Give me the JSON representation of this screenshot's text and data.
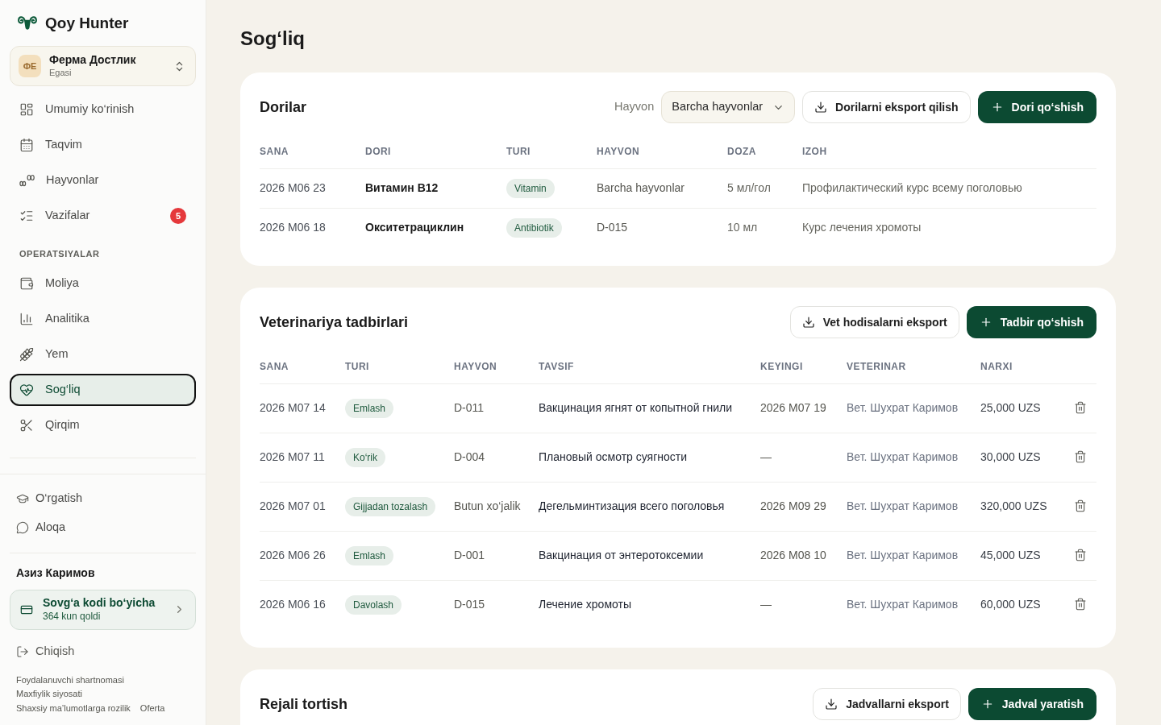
{
  "sidebar": {
    "brand": "Qoy Hunter",
    "farm": {
      "initials": "ФЕ",
      "name": "Ферма Достлик",
      "role": "Egasi"
    },
    "nav": [
      {
        "kind": "overview",
        "label": "Umumiy ko‘rinish",
        "selected": false
      },
      {
        "kind": "calendar",
        "label": "Taqvim",
        "selected": false
      },
      {
        "kind": "animals",
        "label": "Hayvonlar",
        "selected": false
      },
      {
        "kind": "tasks",
        "label": "Vazifalar",
        "selected": false,
        "badge": "5"
      }
    ],
    "section_title": "OPERATSIYALAR",
    "operations": [
      {
        "kind": "finance",
        "label": "Moliya",
        "selected": false
      },
      {
        "kind": "analytics",
        "label": "Analitika",
        "selected": false
      },
      {
        "kind": "feed",
        "label": "Yem",
        "selected": false
      },
      {
        "kind": "health",
        "label": "Sog‘liq",
        "selected": true
      },
      {
        "kind": "shearing",
        "label": "Qirqim",
        "selected": false
      }
    ],
    "help_links": [
      {
        "kind": "learning",
        "label": "O‘rgatish"
      },
      {
        "kind": "contact",
        "label": "Aloqa"
      }
    ],
    "user_name": "Азиз Каримов",
    "subscription": {
      "title": "Sovg‘a kodi bo‘yicha",
      "remaining": "364 kun qoldi"
    },
    "logout": "Chiqish",
    "legal_links": [
      [
        "Foydalanuvchi shartnomasi"
      ],
      [
        "Maxfiylik siyosati"
      ],
      [
        "Shaxsiy ma’lumotlarga rozilik",
        "Oferta"
      ]
    ]
  },
  "page_title": "Sog‘liq",
  "medicines": {
    "title": "Dorilar",
    "filter": {
      "label": "Hayvon",
      "value": "Barcha hayvonlar"
    },
    "export_button": "Dorilarni eksport qilish",
    "add_button": "Dori qo‘shish",
    "columns": [
      "SANA",
      "DORI",
      "TURI",
      "HAYVON",
      "DOZA",
      "IZOH"
    ],
    "rows": [
      {
        "date": "2026 M06 23",
        "medicine": "Витамин B12",
        "type": "Vitamin",
        "animal": "Barcha hayvonlar",
        "dose": "5 мл/гол",
        "note": "Профилактический курс всему поголовью"
      },
      {
        "date": "2026 M06 18",
        "medicine": "Окситетрациклин",
        "type": "Antibiotik",
        "animal": "D-015",
        "dose": "10 мл",
        "note": "Курс лечения хромоты"
      }
    ]
  },
  "vet_events": {
    "title": "Veterinariya tadbirlari",
    "export_button": "Vet hodisalarni eksport",
    "add_button": "Tadbir qo‘shish",
    "columns": [
      "SANA",
      "TURI",
      "HAYVON",
      "TAVSIF",
      "KEYINGI",
      "VETERINAR",
      "NARXI"
    ],
    "rows": [
      {
        "date": "2026 M07 14",
        "type": "Emlash",
        "animal": "D-011",
        "description": "Вакцинация ягнят от копытной гнили",
        "next": "2026 M07 19",
        "vet": "Вет. Шухрат Каримов",
        "price": "25,000 UZS"
      },
      {
        "date": "2026 M07 11",
        "type": "Ko‘rik",
        "animal": "D-004",
        "description": "Плановый осмотр суягности",
        "next": "—",
        "vet": "Вет. Шухрат Каримов",
        "price": "30,000 UZS"
      },
      {
        "date": "2026 M07 01",
        "type": "Gijjadan tozalash",
        "animal": "Butun xo‘jalik",
        "description": "Дегельминтизация всего поголовья",
        "next": "2026 M09 29",
        "vet": "Вет. Шухрат Каримов",
        "price": "320,000 UZS"
      },
      {
        "date": "2026 M06 26",
        "type": "Emlash",
        "animal": "D-001",
        "description": "Вакцинация от энтеротоксемии",
        "next": "2026 M08 10",
        "vet": "Вет. Шухрат Каримов",
        "price": "45,000 UZS"
      },
      {
        "date": "2026 M06 16",
        "type": "Davolash",
        "animal": "D-015",
        "description": "Лечение хромоты",
        "next": "—",
        "vet": "Вет. Шухрат Каримов",
        "price": "60,000 UZS"
      }
    ]
  },
  "weighing": {
    "title": "Rejali tortish",
    "export_button": "Jadvallarni eksport",
    "add_button": "Jadval yaratish"
  }
}
